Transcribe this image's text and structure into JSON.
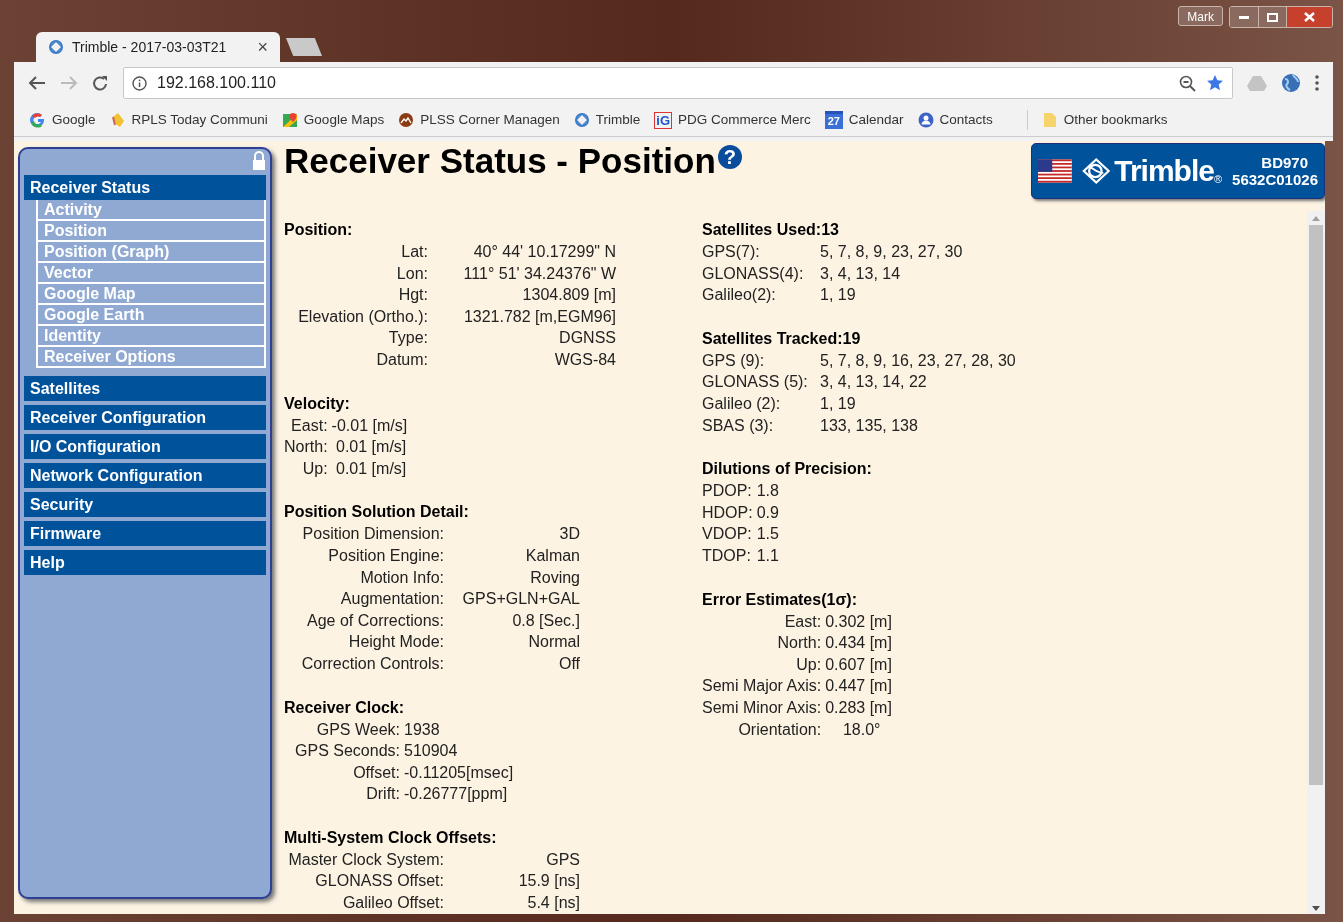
{
  "browser": {
    "tabs": [
      {
        "title": "Trimble - 2017-03-03T21",
        "selected": true,
        "close": "×"
      }
    ],
    "user": "Mark",
    "url": "192.168.100.110",
    "bookmarks": [
      {
        "kind": "google",
        "label": "Google"
      },
      {
        "kind": "hand",
        "label": "RPLS Today Communi"
      },
      {
        "kind": "maps",
        "label": "Google Maps"
      },
      {
        "kind": "plss",
        "label": "PLSS Corner Managen"
      },
      {
        "kind": "trimble",
        "label": "Trimble"
      },
      {
        "kind": "ig",
        "badge": "iG",
        "label": "PDG Commerce Merc"
      },
      {
        "kind": "calendar",
        "badge": "27",
        "label": "Calendar"
      },
      {
        "kind": "contacts",
        "label": "Contacts"
      },
      {
        "kind": "folder",
        "label": "Other bookmarks"
      }
    ]
  },
  "sidebar": {
    "items": [
      {
        "label": "Receiver Status",
        "children": [
          {
            "label": "Activity"
          },
          {
            "label": "Position"
          },
          {
            "label": "Position (Graph)"
          },
          {
            "label": "Vector"
          },
          {
            "label": "Google Map"
          },
          {
            "label": "Google Earth"
          },
          {
            "label": "Identity"
          },
          {
            "label": "Receiver Options"
          }
        ]
      },
      {
        "label": "Satellites"
      },
      {
        "label": "Receiver Configuration"
      },
      {
        "label": "I/O Configuration"
      },
      {
        "label": "Network Configuration"
      },
      {
        "label": "Security"
      },
      {
        "label": "Firmware"
      },
      {
        "label": "Help"
      }
    ]
  },
  "page": {
    "title": "Receiver Status - Position",
    "help": "?"
  },
  "logo": {
    "brand": "Trimble",
    "mark": "®",
    "model": "BD970",
    "serial": "5632C01026"
  },
  "columns": [
    [
      {
        "heading": "Position:",
        "kind": "coords",
        "rows": [
          {
            "label": "Lat:",
            "value": "40° 44' 10.17299\" N"
          },
          {
            "label": "Lon:",
            "value": "111° 51' 34.24376\" W"
          },
          {
            "label": "Hgt:",
            "value": "1304.809 [m]"
          },
          {
            "label": "Elevation (Ortho.):",
            "value": "1321.782 [m,EGM96]"
          },
          {
            "label": "Type:",
            "value": "DGNSS"
          },
          {
            "label": "Datum:",
            "value": "WGS-84"
          }
        ]
      },
      {
        "heading": "Velocity:",
        "kind": "paired",
        "rows": [
          {
            "label": "East:",
            "value": "-0.01 [m/s]"
          },
          {
            "label": "North:",
            "value": " 0.01 [m/s]"
          },
          {
            "label": "Up:",
            "value": " 0.01 [m/s]"
          }
        ]
      },
      {
        "heading": "Position Solution Detail:",
        "kind": "aligned",
        "rows": [
          {
            "label": "Position Dimension:",
            "value": "3D"
          },
          {
            "label": "Position Engine:",
            "value": "Kalman"
          },
          {
            "label": "Motion Info:",
            "value": "Roving"
          },
          {
            "label": "Augmentation:",
            "value": "GPS+GLN+GAL"
          },
          {
            "label": "Age of Corrections:",
            "value": "0.8 [Sec.]"
          },
          {
            "label": "Height Mode:",
            "value": "Normal"
          },
          {
            "label": "Correction Controls:",
            "value": "Off"
          }
        ]
      },
      {
        "heading": "Receiver Clock:",
        "kind": "clock",
        "rows": [
          {
            "label": "GPS Week:",
            "value": "1938"
          },
          {
            "label": "GPS Seconds:",
            "value": "510904"
          },
          {
            "label": "Offset:",
            "value": "-0.11205[msec]"
          },
          {
            "label": "Drift:",
            "value": "-0.26777[ppm]"
          }
        ]
      },
      {
        "heading": "Multi-System Clock Offsets:",
        "kind": "aligned",
        "rows": [
          {
            "label": "Master Clock System:",
            "value": "GPS"
          },
          {
            "label": "GLONASS Offset:",
            "value": "15.9 [ns]"
          },
          {
            "label": "Galileo Offset:",
            "value": "5.4 [ns]"
          }
        ]
      }
    ],
    [
      {
        "heading": "Satellites Used:13",
        "kind": "list",
        "rows": [
          {
            "label": "GPS(7):",
            "value": "5, 7, 8, 9, 23, 27, 30"
          },
          {
            "label": "GLONASS(4):",
            "value": "3, 4, 13, 14"
          },
          {
            "label": "Galileo(2):",
            "value": "1, 19"
          }
        ]
      },
      {
        "heading": "Satellites Tracked:19",
        "kind": "list",
        "rows": [
          {
            "label": "GPS (9):",
            "value": "5, 7, 8, 9, 16, 23, 27, 28, 30"
          },
          {
            "label": "GLONASS (5):",
            "value": "3, 4, 13, 14, 22"
          },
          {
            "label": "Galileo (2):",
            "value": "1, 19"
          },
          {
            "label": "SBAS (3):",
            "value": "133, 135, 138"
          }
        ]
      },
      {
        "heading": "Dilutions of Precision:",
        "kind": "dop",
        "rows": [
          {
            "label": "PDOP:",
            "value": "1.8"
          },
          {
            "label": "HDOP:",
            "value": "0.9"
          },
          {
            "label": "VDOP:",
            "value": "1.5"
          },
          {
            "label": "TDOP:",
            "value": "1.1"
          }
        ]
      },
      {
        "heading": "Error Estimates(1σ):",
        "kind": "paired",
        "rows": [
          {
            "label": "East:",
            "value": "0.302 [m]"
          },
          {
            "label": "North:",
            "value": "0.434 [m]"
          },
          {
            "label": "Up:",
            "value": "0.607 [m]"
          },
          {
            "label": "Semi Major Axis:",
            "value": "0.447 [m]"
          },
          {
            "label": "Semi Minor Axis:",
            "value": "0.283 [m]"
          },
          {
            "label": "Orientation:",
            "value": "    18.0°"
          }
        ]
      }
    ]
  ]
}
